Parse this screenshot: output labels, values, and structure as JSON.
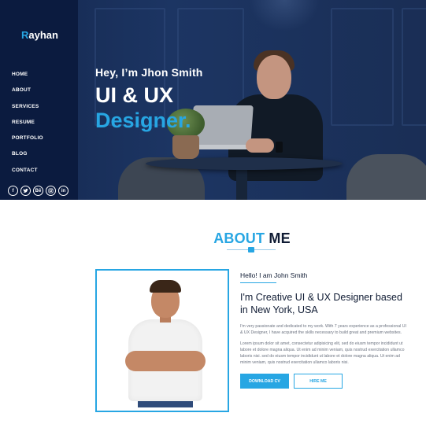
{
  "brand": {
    "first_letter": "R",
    "rest": "ayhan"
  },
  "nav": {
    "items": [
      "HOME",
      "ABOUT",
      "SERVICES",
      "RESUME",
      "PORTFOLIO",
      "BLOG",
      "CONTACT"
    ]
  },
  "socials": [
    {
      "name": "facebook-icon",
      "glyph": "f"
    },
    {
      "name": "twitter-icon",
      "glyph": ""
    },
    {
      "name": "behance-icon",
      "glyph": "Bē"
    },
    {
      "name": "instagram-icon",
      "glyph": ""
    },
    {
      "name": "linkedin-icon",
      "glyph": "in"
    }
  ],
  "hero": {
    "greeting": "Hey, I’m Jhon Smith",
    "title_line1": "UI & UX",
    "title_line2": "Designer."
  },
  "about": {
    "heading_accent": "ABOUT",
    "heading_rest": " ME",
    "hello": "Hello! I am John Smith",
    "title": "I'm Creative UI & UX Designer based in New York, USA",
    "paragraph1": "I'm very passionate and dedicated to my work. With 7 years experience as a professional UI & UX Designer, I have acquired the skills necessary to build great and premium websites.",
    "paragraph2": "Lorem ipsum dolor sit amet, consectetur adipisicing elit, sed do eiusm tempor incididunt ut labore et dolore magna aliqua. Ut enim ad minim veniam, quis nostrud exercitation ullamco laboris nisi. sed do eiusm tempor incididunt ut labore et dolore magna aliqua. Ut enim ad minim veniam, quis nostrud exercitation ullamco laboris nisi.",
    "download_button": "DOWNLOAD CV",
    "hire_button": "HIRE ME"
  },
  "colors": {
    "accent": "#27a6e3",
    "sidebar": "#0b1b3f",
    "dark_text": "#0f1b33"
  }
}
